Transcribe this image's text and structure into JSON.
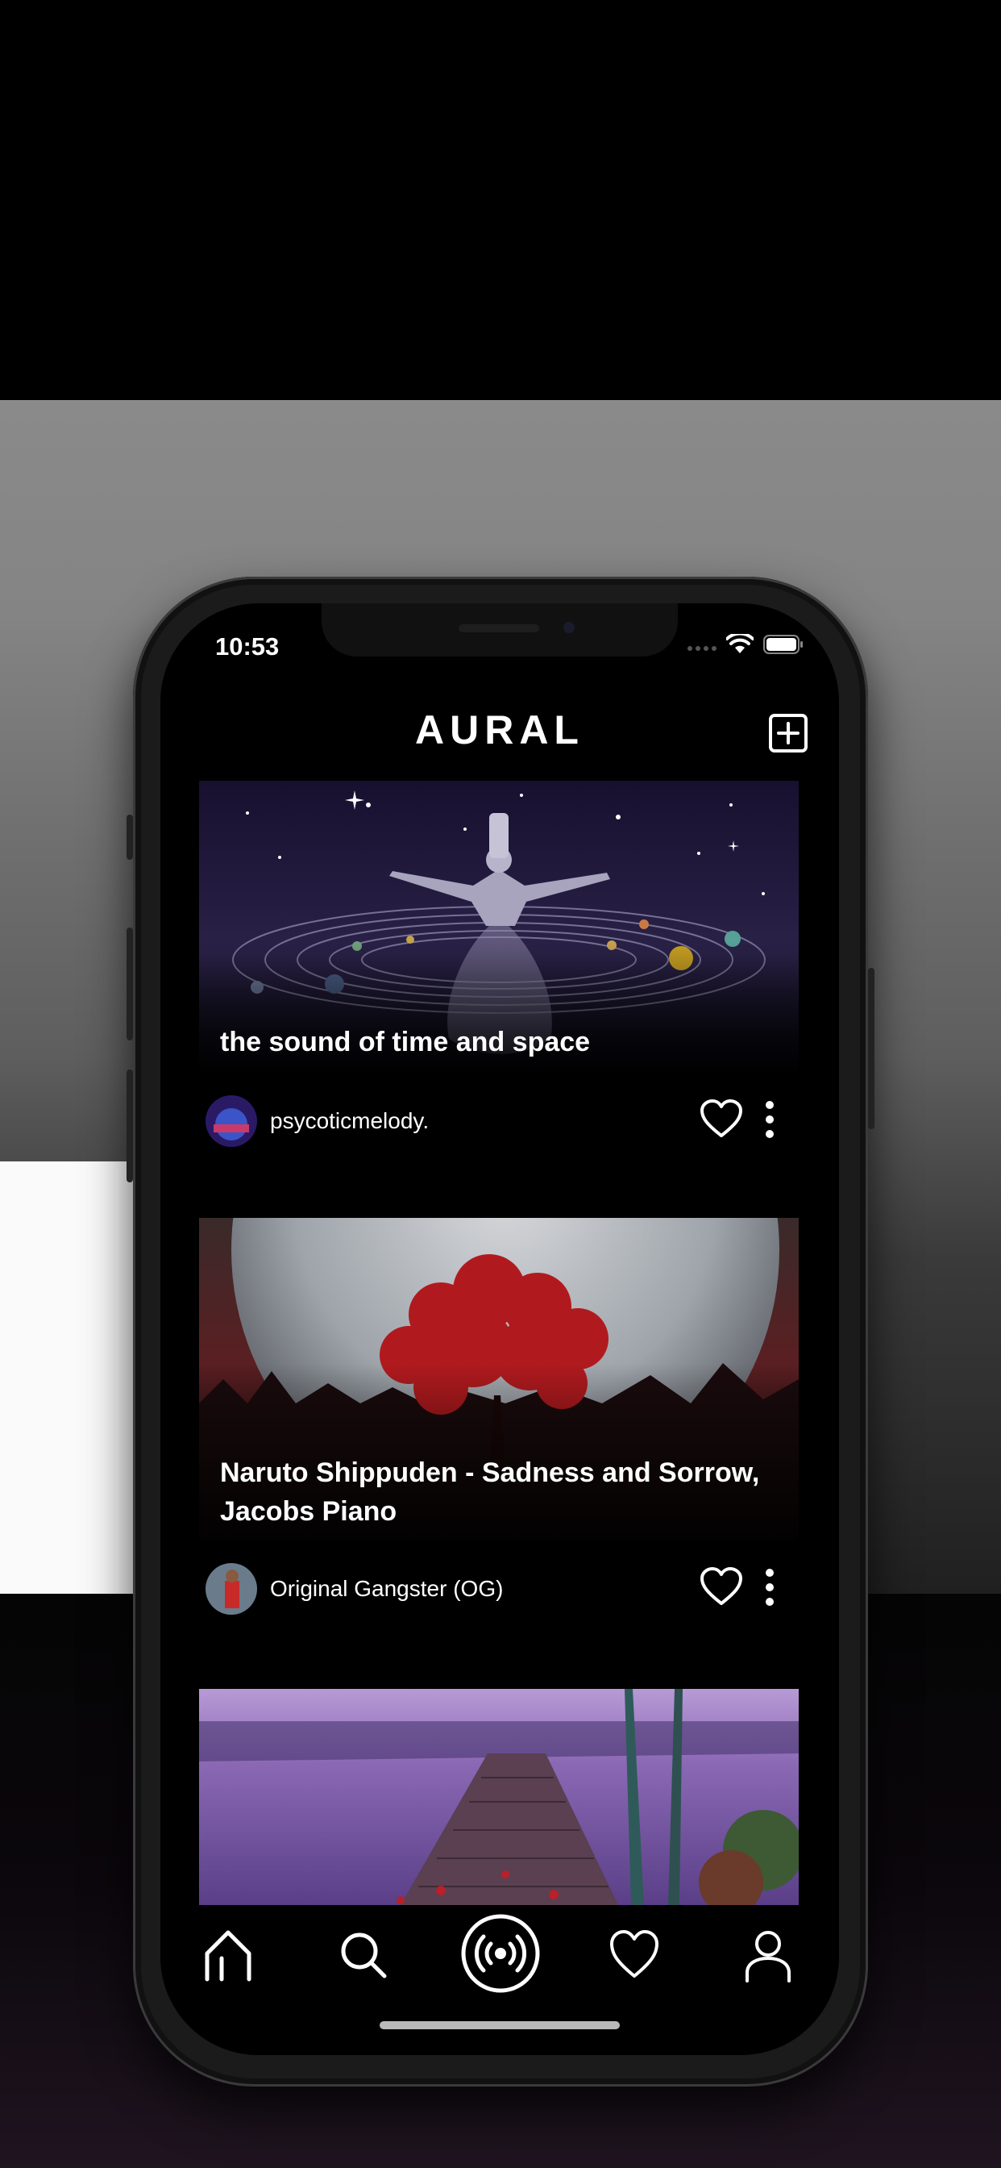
{
  "status_bar": {
    "time": "10:53"
  },
  "header": {
    "title": "AURAL",
    "add_icon": "plus-square-icon"
  },
  "feed": {
    "cards": [
      {
        "title": "the sound of time and space",
        "author": "psycoticmelody."
      },
      {
        "title": "Naruto Shippuden - Sadness and Sorrow, Jacobs Piano",
        "author": "Original Gangster (OG)"
      },
      {
        "title": "",
        "author": ""
      }
    ]
  },
  "tab_bar": {
    "items": [
      {
        "icon": "home-icon"
      },
      {
        "icon": "search-icon"
      },
      {
        "icon": "broadcast-icon"
      },
      {
        "icon": "heart-icon"
      },
      {
        "icon": "profile-icon"
      }
    ]
  },
  "colors": {
    "background": "#000000",
    "text": "#ffffff",
    "icon": "#ffffff"
  }
}
